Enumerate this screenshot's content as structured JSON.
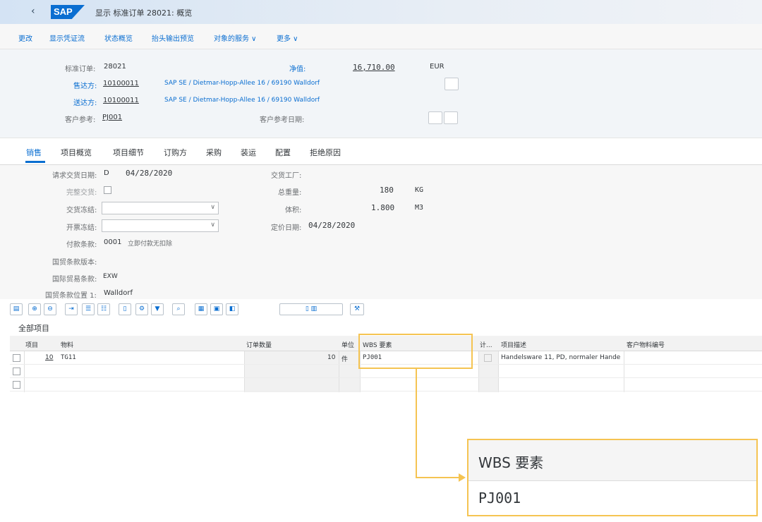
{
  "shell": {
    "back": "‹",
    "logo": "SAP",
    "title": "显示 标准订单 28021: 概览"
  },
  "toolbar": {
    "items": [
      "更改",
      "显示凭证流",
      "状态概览",
      "抬头输出预览",
      "对象的服务 ∨",
      "更多 ∨"
    ]
  },
  "header": {
    "order_label": "标准订单:",
    "order_value": "28021",
    "net_label": "净值:",
    "net_value": "16,710.00",
    "currency": "EUR",
    "soldto_label": "售达方:",
    "soldto_value": "10100011",
    "soldto_addr": "SAP SE / Dietmar-Hopp-Allee 16 / 69190 Walldorf",
    "shipto_label": "送达方:",
    "shipto_value": "10100011",
    "shipto_addr": "SAP SE / Dietmar-Hopp-Allee 16 / 69190 Walldorf",
    "custref_label": "客户参考:",
    "custref_value": "PJ001",
    "custref_date_label": "客户参考日期:"
  },
  "tabs": [
    "销售",
    "项目概览",
    "项目细节",
    "订购方",
    "采购",
    "装运",
    "配置",
    "拒绝原因"
  ],
  "form": {
    "req_date_label": "请求交货日期:",
    "req_date_type": "D",
    "req_date_value": "04/28/2020",
    "complete_label": "完整交货:",
    "delivery_block_label": "交货冻结:",
    "billing_block_label": "开票冻结:",
    "payment_label": "付款条款:",
    "payment_value": "0001",
    "payment_desc": "立即付款无扣除",
    "incoterms_ver_label": "国贸条款版本:",
    "incoterms_label": "国际贸易条款:",
    "incoterms_value": "EXW",
    "incoterms_loc_label": "国贸条款位置 1:",
    "incoterms_loc_value": "Walldorf",
    "plant_label": "交货工厂:",
    "weight_label": "总重量:",
    "weight_value": "180",
    "weight_unit": "KG",
    "volume_label": "体积:",
    "volume_value": "1.800",
    "volume_unit": "M3",
    "pricing_date_label": "定价日期:",
    "pricing_date_value": "04/28/2020"
  },
  "section_title": "全部项目",
  "table": {
    "headers": [
      "项目",
      "物料",
      "订单数量",
      "单位",
      "WBS 要素",
      "计...",
      "项目描述",
      "客户物料编号"
    ],
    "rows": [
      {
        "item": "10",
        "material": "TG11",
        "qty": "10",
        "unit": "件",
        "wbs": "PJ001",
        "desc": "Handelsware 11, PD, normaler Hande"
      }
    ]
  },
  "zoom": {
    "header": "WBS 要素",
    "value": "PJ001"
  }
}
